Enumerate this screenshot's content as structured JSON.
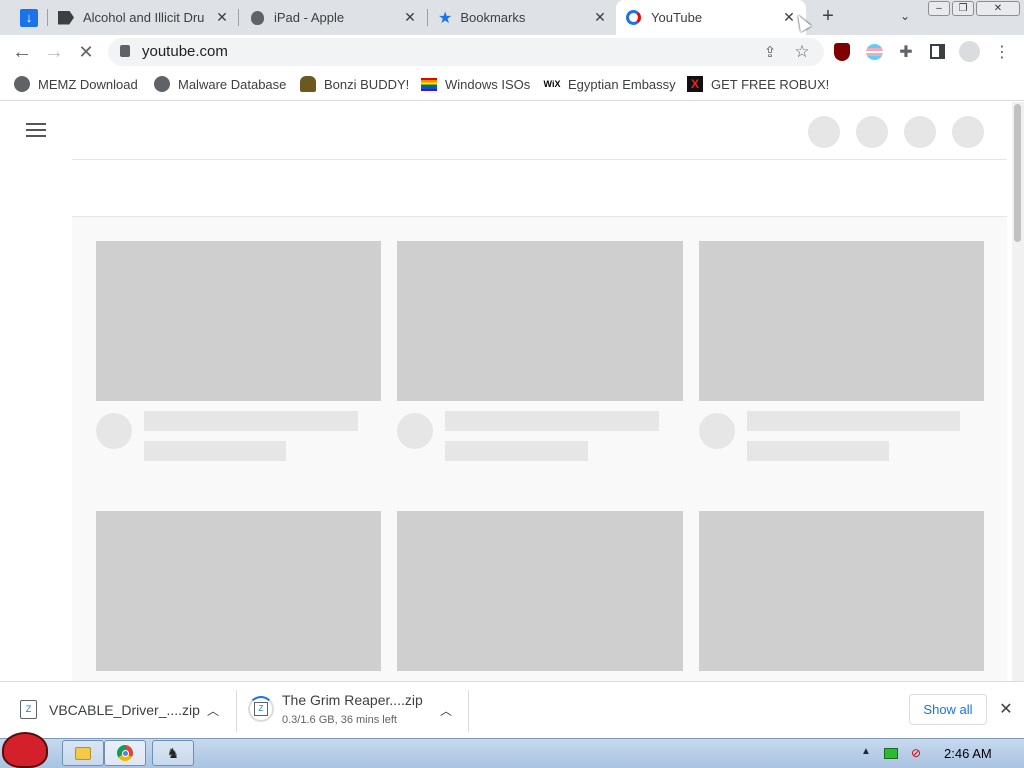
{
  "tabs": [
    {
      "label": "",
      "icon": "download-arrow-icon"
    },
    {
      "label": "Alcohol and Illicit Dru",
      "icon": "flag-icon"
    },
    {
      "label": "iPad - Apple",
      "icon": "apple-icon"
    },
    {
      "label": "Bookmarks",
      "icon": "star-icon"
    },
    {
      "label": "YouTube",
      "icon": "loading-icon",
      "active": true
    }
  ],
  "window_controls": {
    "minimize": "–",
    "restore": "❐",
    "close": "✕"
  },
  "toolbar": {
    "url": "youtube.com",
    "new_tab": "+"
  },
  "bookmarks": [
    {
      "label": "MEMZ Download",
      "icon": "globe-icon"
    },
    {
      "label": "Malware Database",
      "icon": "globe-icon"
    },
    {
      "label": "Bonzi BUDDY!",
      "icon": "bonzi-icon"
    },
    {
      "label": "Windows ISOs",
      "icon": "rainbow-flag-icon"
    },
    {
      "label": "Egyptian Embassy",
      "icon": "wix-icon"
    },
    {
      "label": "GET FREE ROBUX!",
      "icon": "roblox-icon"
    }
  ],
  "downloads": [
    {
      "name": "VBCABLE_Driver_....zip",
      "status": ""
    },
    {
      "name": "The Grim Reaper....zip",
      "status": "0.3/1.6 GB, 36 mins left"
    }
  ],
  "download_bar": {
    "show_all": "Show all",
    "close": "✕"
  },
  "taskbar": {
    "clock": "2:46 AM"
  },
  "colors": {
    "accent": "#1a73e8",
    "tabstrip": "#dee1e6",
    "skeleton": "#cfcfcf",
    "skeleton_light": "#e6e6e6",
    "youtube_red": "#ff0000"
  }
}
